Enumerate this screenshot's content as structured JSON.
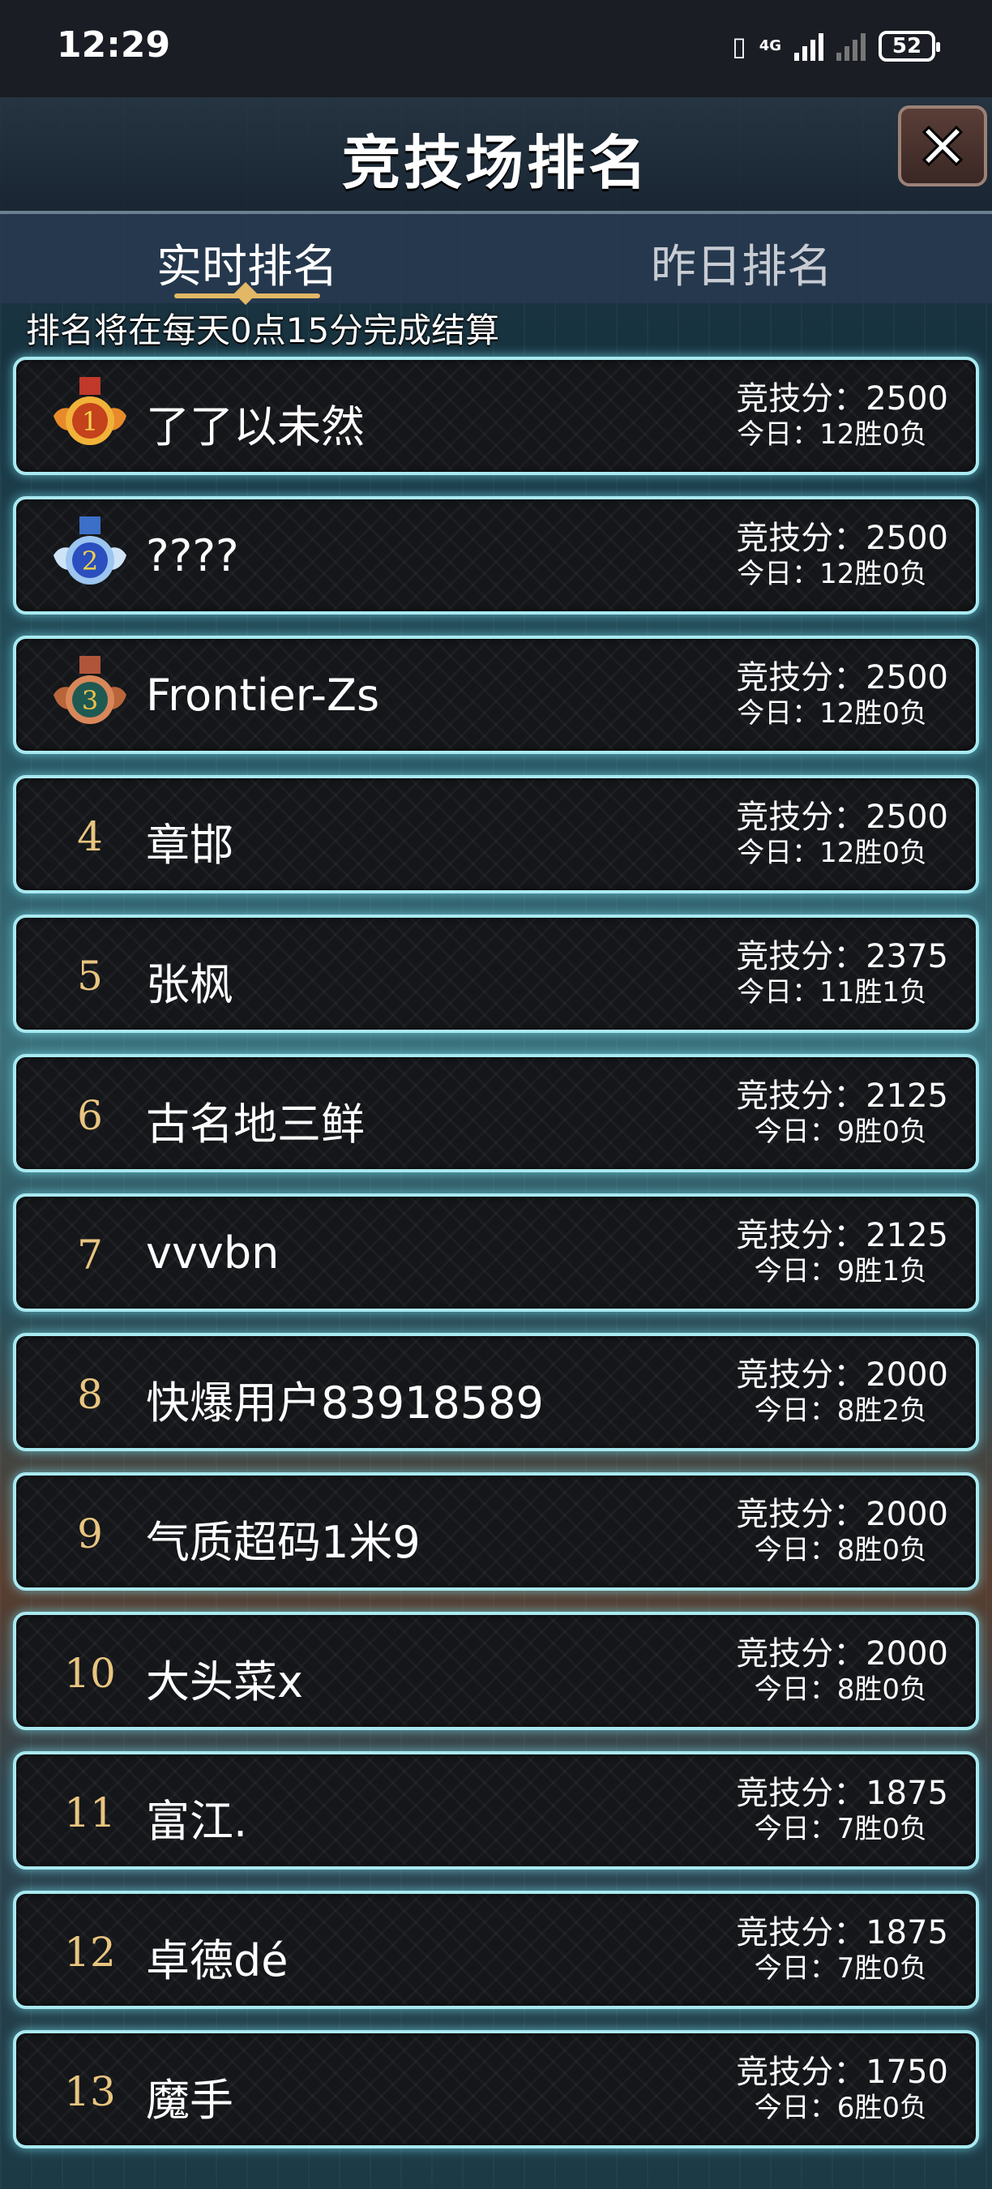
{
  "status_bar": {
    "time": "12:29",
    "network": "4G",
    "battery": "52"
  },
  "header": {
    "title": "竞技场排名",
    "close_icon": "close-icon"
  },
  "tabs": [
    {
      "label": "实时排名",
      "active": true
    },
    {
      "label": "昨日排名",
      "active": false
    }
  ],
  "notice": "排名将在每天0点15分完成结算",
  "accent": "#a9e9f0",
  "rows": [
    {
      "rank": "1",
      "medal": "gold",
      "name": "了了以未然",
      "score": "竞技分：2500",
      "record": "今日：12胜0负"
    },
    {
      "rank": "2",
      "medal": "silver",
      "name": "????",
      "score": "竞技分：2500",
      "record": "今日：12胜0负"
    },
    {
      "rank": "3",
      "medal": "bronze",
      "name": "Frontier-Zs",
      "score": "竞技分：2500",
      "record": "今日：12胜0负"
    },
    {
      "rank": "4",
      "name": "章邯",
      "score": "竞技分：2500",
      "record": "今日：12胜0负"
    },
    {
      "rank": "5",
      "name": "张枫",
      "score": "竞技分：2375",
      "record": "今日：11胜1负"
    },
    {
      "rank": "6",
      "name": "古名地三鲜",
      "score": "竞技分：2125",
      "record": "今日：9胜0负"
    },
    {
      "rank": "7",
      "name": "vvvbn",
      "score": "竞技分：2125",
      "record": "今日：9胜1负"
    },
    {
      "rank": "8",
      "name": "快爆用户83918589",
      "score": "竞技分：2000",
      "record": "今日：8胜2负"
    },
    {
      "rank": "9",
      "name": "气质超码1米9",
      "score": "竞技分：2000",
      "record": "今日：8胜0负"
    },
    {
      "rank": "10",
      "name": "大头菜x",
      "score": "竞技分：2000",
      "record": "今日：8胜0负"
    },
    {
      "rank": "11",
      "name": "富江.",
      "score": "竞技分：1875",
      "record": "今日：7胜0负"
    },
    {
      "rank": "12",
      "name": "卓德dé",
      "score": "竞技分：1875",
      "record": "今日：7胜0负"
    },
    {
      "rank": "13",
      "name": "魔手",
      "score": "竞技分：1750",
      "record": "今日：6胜0负"
    }
  ]
}
